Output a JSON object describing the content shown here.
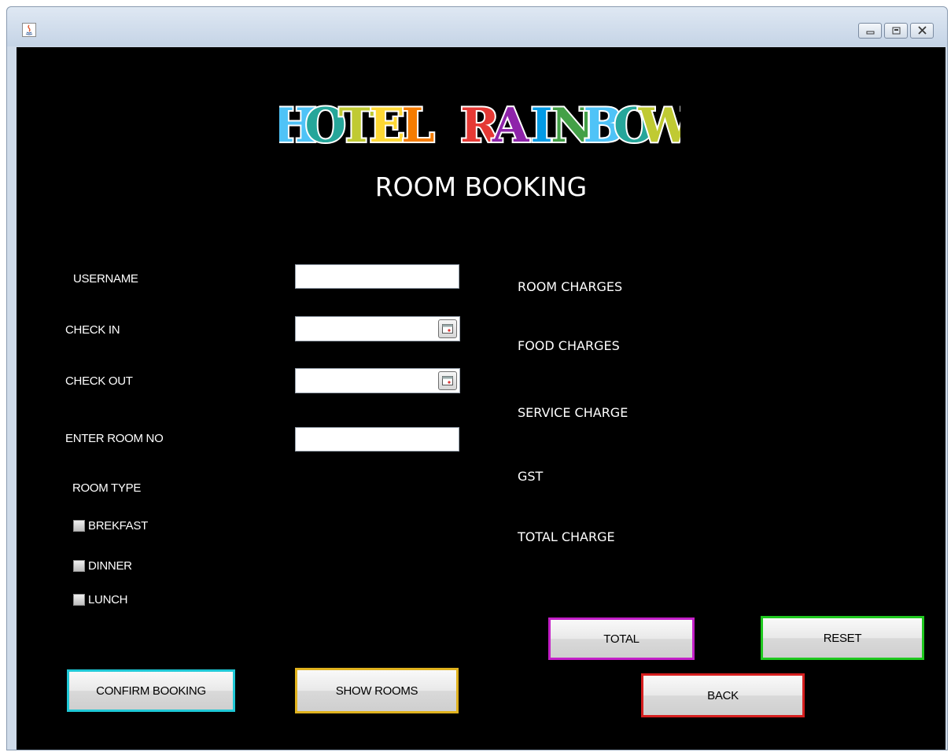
{
  "window": {
    "colors": {
      "content_bg": "#000000",
      "titlebar": "#cfdbe9"
    },
    "controls": [
      "minimize-icon",
      "maximize-icon",
      "close-icon"
    ]
  },
  "header": {
    "logo_text": "HOTEL RAINBOW",
    "logo_colors": [
      "#4fc3f7",
      "#26a69a",
      "#c0ca33",
      "#fdd835",
      "#f57c00",
      "#e53935",
      "#8e24aa",
      "#039be5",
      "#43a047"
    ],
    "title": "ROOM BOOKING"
  },
  "form": {
    "username_label": "USERNAME",
    "username_value": "",
    "checkin_label": "CHECK IN",
    "checkin_value": "",
    "checkout_label": "CHECK OUT",
    "checkout_value": "",
    "roomno_label": "ENTER ROOM NO",
    "roomno_value": "",
    "roomtype_label": "ROOM TYPE",
    "meals": [
      {
        "label": "BREKFAST",
        "checked": false
      },
      {
        "label": "DINNER",
        "checked": false
      },
      {
        "label": "LUNCH",
        "checked": false
      }
    ]
  },
  "charges": {
    "room_label": "ROOM CHARGES",
    "food_label": "FOOD CHARGES",
    "service_label": "SERVICE CHARGE",
    "gst_label": "GST",
    "total_label": "TOTAL CHARGE"
  },
  "buttons": {
    "confirm": {
      "label": "CONFIRM BOOKING",
      "border": "#1fc8d6"
    },
    "show_rooms": {
      "label": "SHOW ROOMS",
      "border": "#e0b21e"
    },
    "total": {
      "label": "TOTAL",
      "border": "#c41fc8"
    },
    "reset": {
      "label": "RESET",
      "border": "#1fc81f"
    },
    "back": {
      "label": "BACK",
      "border": "#d61f1f"
    }
  }
}
